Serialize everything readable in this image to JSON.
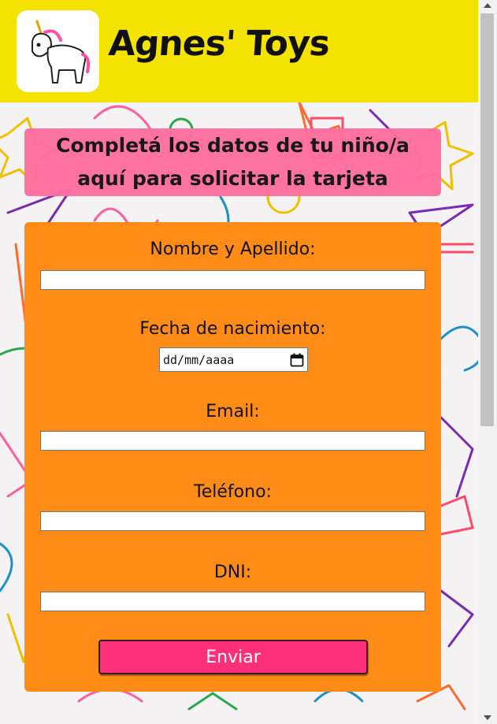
{
  "header": {
    "brand_name": "Agnes' Toys",
    "logo_icon": "unicorn-icon",
    "background_color": "#f4e300"
  },
  "banner": {
    "line1": "Completá los datos de tu niño/a",
    "line2": "aquí para solicitar la tarjeta",
    "background_color": "#ff6fa0"
  },
  "form": {
    "background_color": "#ff8c17",
    "fields": {
      "name_label": "Nombre y Apellido:",
      "name_value": "",
      "birth_label": "Fecha de nacimiento:",
      "birth_placeholder": "dd/mm/aaaa",
      "email_label": "Email:",
      "email_value": "",
      "phone_label": "Teléfono:",
      "phone_value": "",
      "dni_label": "DNI:",
      "dni_value": ""
    },
    "submit_label": "Enviar",
    "submit_color": "#ff2f78"
  }
}
